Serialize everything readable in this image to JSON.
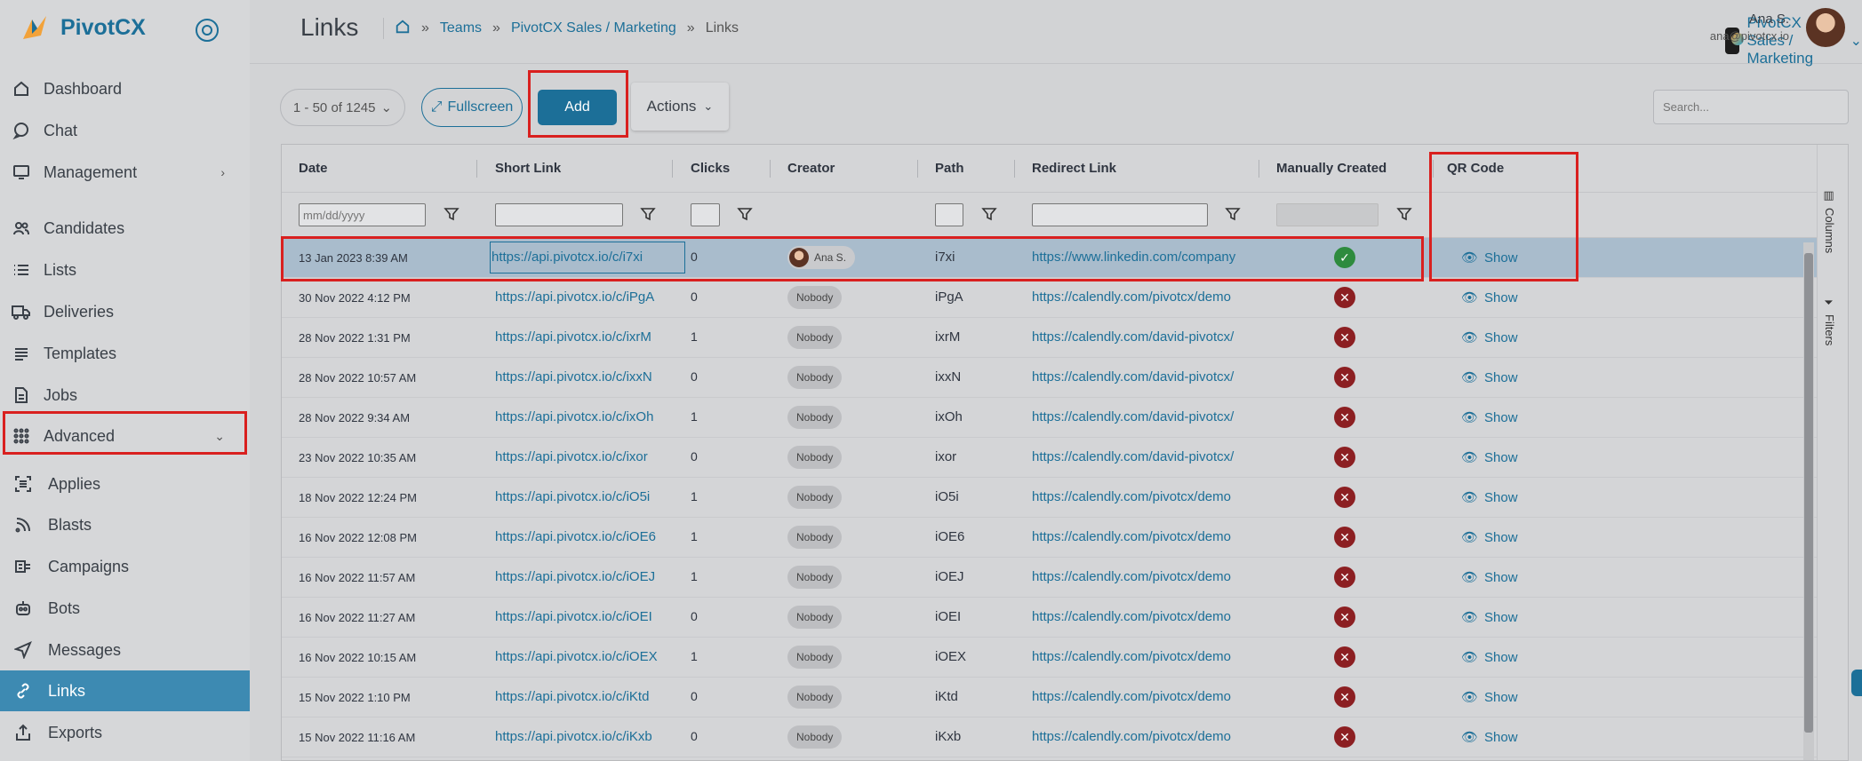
{
  "app": {
    "name": "PivotCX"
  },
  "sidebar": {
    "items": [
      {
        "label": "Dashboard",
        "icon": "home-icon"
      },
      {
        "label": "Chat",
        "icon": "chat-bubble-icon"
      },
      {
        "label": "Management",
        "icon": "monitor-icon"
      },
      {
        "label": "Candidates",
        "icon": "users-icon"
      },
      {
        "label": "Lists",
        "icon": "list-icon"
      },
      {
        "label": "Deliveries",
        "icon": "truck-icon"
      },
      {
        "label": "Templates",
        "icon": "lines-icon"
      },
      {
        "label": "Jobs",
        "icon": "document-icon"
      },
      {
        "label": "Advanced",
        "icon": "grid-icon"
      }
    ],
    "subitems": [
      {
        "label": "Applies",
        "icon": "scan-icon"
      },
      {
        "label": "Blasts",
        "icon": "rss-icon"
      },
      {
        "label": "Campaigns",
        "icon": "campaign-icon"
      },
      {
        "label": "Bots",
        "icon": "robot-icon"
      },
      {
        "label": "Messages",
        "icon": "send-icon"
      },
      {
        "label": "Links",
        "icon": "link-icon"
      },
      {
        "label": "Exports",
        "icon": "upload-icon"
      }
    ]
  },
  "header": {
    "title": "Links",
    "breadcrumbs": [
      "Teams",
      "PivotCX Sales / Marketing",
      "Links"
    ],
    "team": "PivotCX Sales / Marketing",
    "user_name": "Ana S.",
    "user_email": "ana@pivotcx.io"
  },
  "toolbar": {
    "pager": "1 - 50 of 1245",
    "fullscreen": "Fullscreen",
    "add": "Add",
    "actions": "Actions",
    "search_placeholder": "Search...",
    "date_placeholder": "mm/dd/yyyy"
  },
  "columns": [
    "Date",
    "Short Link",
    "Clicks",
    "Creator",
    "Path",
    "Redirect Link",
    "Manually Created",
    "QR Code"
  ],
  "rail": {
    "columns": "Columns",
    "filters": "Filters"
  },
  "rows": [
    {
      "date": "13 Jan 2023 8:39 AM",
      "short": "https://api.pivotcx.io/c/i7xi",
      "clicks": "0",
      "creator": "Ana S.",
      "path": "i7xi",
      "redirect": "https://www.linkedin.com/company",
      "manual": true,
      "qr": "Show"
    },
    {
      "date": "30 Nov 2022 4:12 PM",
      "short": "https://api.pivotcx.io/c/iPgA",
      "clicks": "0",
      "creator": "Nobody",
      "path": "iPgA",
      "redirect": "https://calendly.com/pivotcx/demo",
      "manual": false,
      "qr": "Show"
    },
    {
      "date": "28 Nov 2022 1:31 PM",
      "short": "https://api.pivotcx.io/c/ixrM",
      "clicks": "1",
      "creator": "Nobody",
      "path": "ixrM",
      "redirect": "https://calendly.com/david-pivotcx/",
      "manual": false,
      "qr": "Show"
    },
    {
      "date": "28 Nov 2022 10:57 AM",
      "short": "https://api.pivotcx.io/c/ixxN",
      "clicks": "0",
      "creator": "Nobody",
      "path": "ixxN",
      "redirect": "https://calendly.com/david-pivotcx/",
      "manual": false,
      "qr": "Show"
    },
    {
      "date": "28 Nov 2022 9:34 AM",
      "short": "https://api.pivotcx.io/c/ixOh",
      "clicks": "1",
      "creator": "Nobody",
      "path": "ixOh",
      "redirect": "https://calendly.com/david-pivotcx/",
      "manual": false,
      "qr": "Show"
    },
    {
      "date": "23 Nov 2022 10:35 AM",
      "short": "https://api.pivotcx.io/c/ixor",
      "clicks": "0",
      "creator": "Nobody",
      "path": "ixor",
      "redirect": "https://calendly.com/david-pivotcx/",
      "manual": false,
      "qr": "Show"
    },
    {
      "date": "18 Nov 2022 12:24 PM",
      "short": "https://api.pivotcx.io/c/iO5i",
      "clicks": "1",
      "creator": "Nobody",
      "path": "iO5i",
      "redirect": "https://calendly.com/pivotcx/demo",
      "manual": false,
      "qr": "Show"
    },
    {
      "date": "16 Nov 2022 12:08 PM",
      "short": "https://api.pivotcx.io/c/iOE6",
      "clicks": "1",
      "creator": "Nobody",
      "path": "iOE6",
      "redirect": "https://calendly.com/pivotcx/demo",
      "manual": false,
      "qr": "Show"
    },
    {
      "date": "16 Nov 2022 11:57 AM",
      "short": "https://api.pivotcx.io/c/iOEJ",
      "clicks": "1",
      "creator": "Nobody",
      "path": "iOEJ",
      "redirect": "https://calendly.com/pivotcx/demo",
      "manual": false,
      "qr": "Show"
    },
    {
      "date": "16 Nov 2022 11:27 AM",
      "short": "https://api.pivotcx.io/c/iOEI",
      "clicks": "0",
      "creator": "Nobody",
      "path": "iOEI",
      "redirect": "https://calendly.com/pivotcx/demo",
      "manual": false,
      "qr": "Show"
    },
    {
      "date": "16 Nov 2022 10:15 AM",
      "short": "https://api.pivotcx.io/c/iOEX",
      "clicks": "1",
      "creator": "Nobody",
      "path": "iOEX",
      "redirect": "https://calendly.com/pivotcx/demo",
      "manual": false,
      "qr": "Show"
    },
    {
      "date": "15 Nov 2022 1:10 PM",
      "short": "https://api.pivotcx.io/c/iKtd",
      "clicks": "0",
      "creator": "Nobody",
      "path": "iKtd",
      "redirect": "https://calendly.com/pivotcx/demo",
      "manual": false,
      "qr": "Show"
    },
    {
      "date": "15 Nov 2022 11:16 AM",
      "short": "https://api.pivotcx.io/c/iKxb",
      "clicks": "0",
      "creator": "Nobody",
      "path": "iKxb",
      "redirect": "https://calendly.com/pivotcx/demo",
      "manual": false,
      "qr": "Show"
    }
  ],
  "colors": {
    "accent": "#1c6f98",
    "active_nav": "#3d8ab2",
    "ok": "#2e8b3e",
    "no": "#8c1f22",
    "highlight": "#d9201f"
  }
}
